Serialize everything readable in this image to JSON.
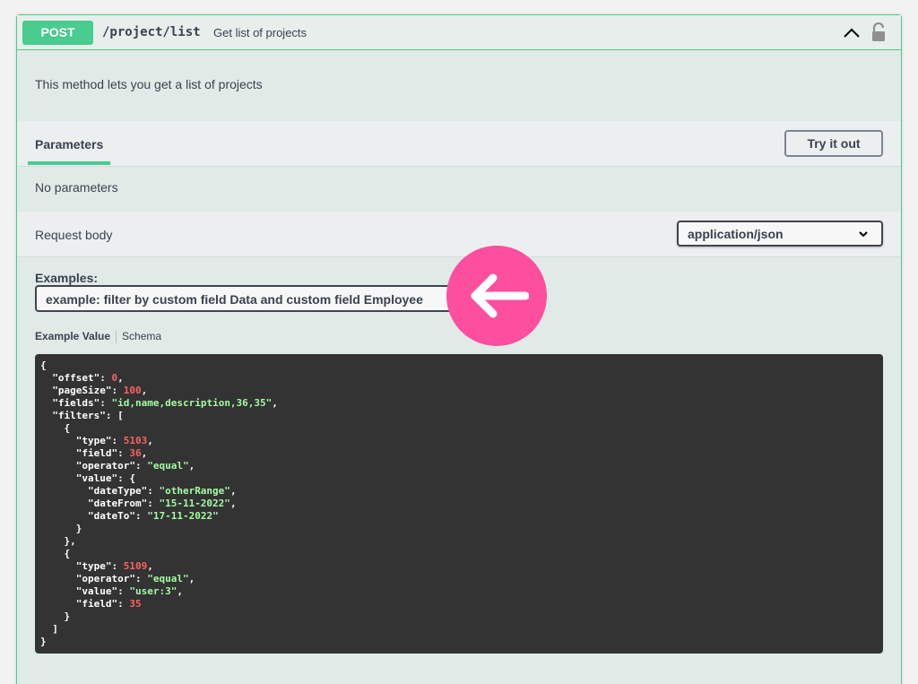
{
  "operation": {
    "method": "POST",
    "path": "/project/list",
    "summary": "Get list of projects",
    "description": "This method lets you get a list of projects"
  },
  "parameters": {
    "tab_label": "Parameters",
    "try_label": "Try it out",
    "empty_text": "No parameters"
  },
  "request_body": {
    "label": "Request body",
    "content_type": "application/json"
  },
  "examples": {
    "label": "Examples:",
    "selected": "example: filter by custom field Data and custom field Employee"
  },
  "tabs": {
    "example_value": "Example Value",
    "schema": "Schema"
  },
  "example_json": {
    "offset": 0,
    "pageSize": 100,
    "fields": "id,name,description,36,35",
    "filters": [
      {
        "type": 5103,
        "field": 36,
        "operator": "equal",
        "value": {
          "dateType": "otherRange",
          "dateFrom": "15-11-2022",
          "dateTo": "17-11-2022"
        }
      },
      {
        "type": 5109,
        "operator": "equal",
        "value": "user:3",
        "field": 35
      }
    ]
  },
  "colors": {
    "method_post": "#49cc90",
    "badge": "#fd4f9e",
    "code_bg": "#333333",
    "code_string": "#a2fca2",
    "code_number": "#fc6262"
  },
  "icons": {
    "collapse": "chevron-up-icon",
    "auth": "unlock-icon",
    "select": "chevron-down-icon",
    "annotation": "arrow-left-icon"
  }
}
